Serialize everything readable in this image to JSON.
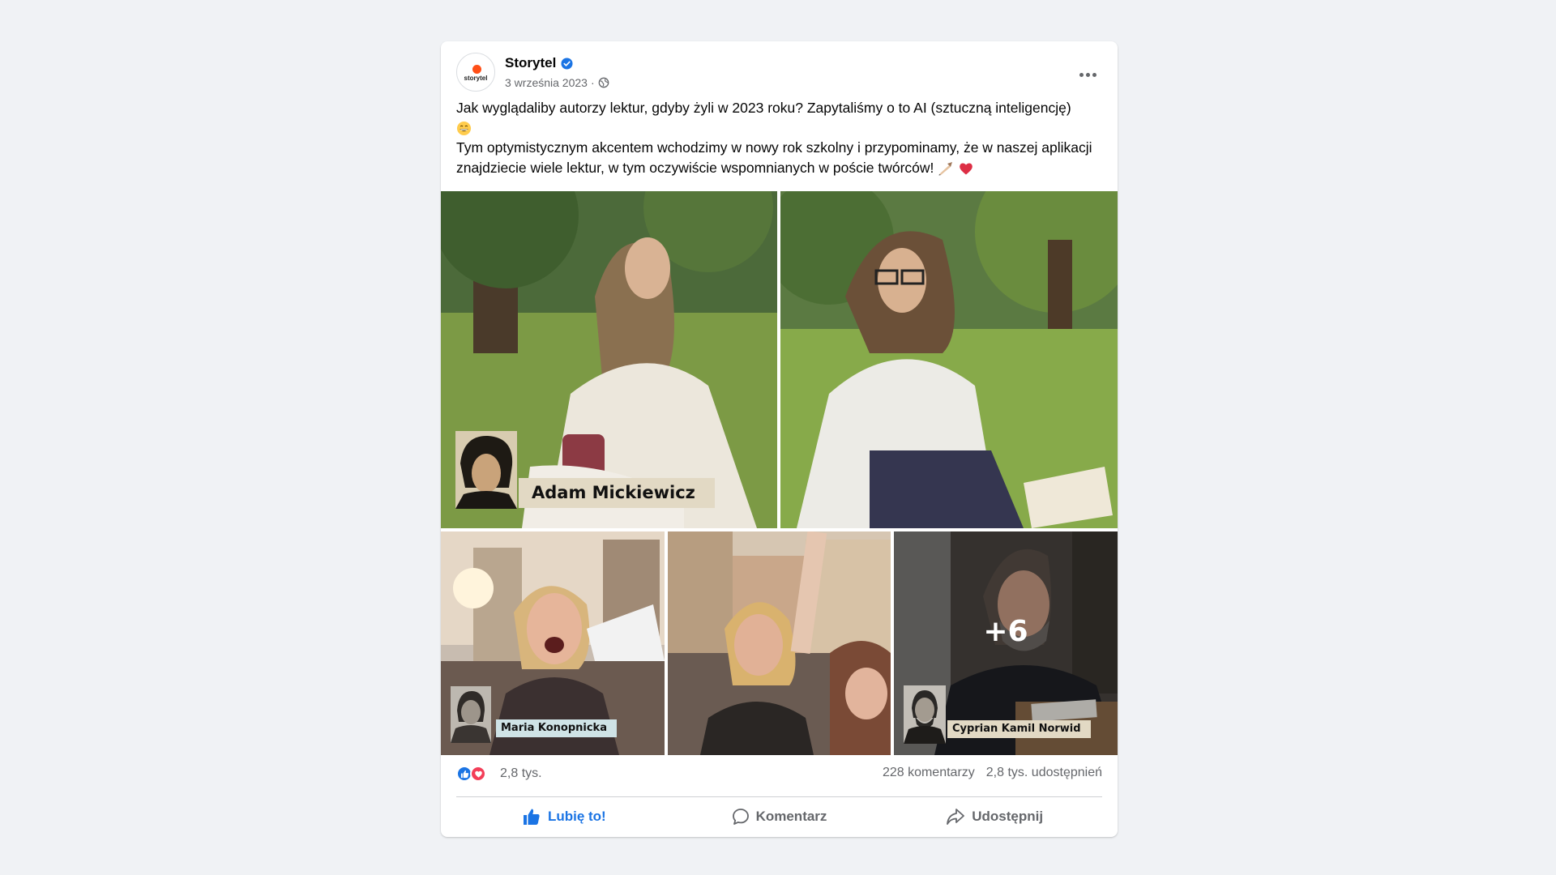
{
  "page": {
    "name": "Storytel",
    "date": "3 września 2023",
    "separator": "·"
  },
  "avatar": {
    "logo_text": "storytel"
  },
  "post": {
    "line1": "Jak wyglądaliby autorzy lektur, gdyby żyli w 2023 roku? Zapytaliśmy o to AI (sztuczną inteligencję)",
    "line2": "Tym optymistycznym akcentem wchodzimy w nowy rok szkolny i przypominamy, że w naszej aplikacji znajdziecie wiele lektur, w tym oczywiście wspomnianych w poście twórców!",
    "emoji1": "grinning-face-emoji",
    "emoji2": [
      "writing-hand-emoji",
      "red-heart-emoji"
    ]
  },
  "photos": {
    "caption_1": "Adam Mickiewicz",
    "caption_3": "Maria Konopnicka",
    "caption_5": "Cyprian Kamil Norwid",
    "more_count": "+6"
  },
  "stats": {
    "reactions": "2,8 tys.",
    "comments": "228 komentarzy",
    "shares": "2,8 tys. udostępnień"
  },
  "actions": {
    "like": "Lubię to!",
    "comment": "Komentarz",
    "share": "Udostępnij"
  },
  "colors": {
    "accent": "#1b74e4",
    "love": "#f33e58",
    "brand": "#ff4f17",
    "secondary_text": "#65676b"
  }
}
